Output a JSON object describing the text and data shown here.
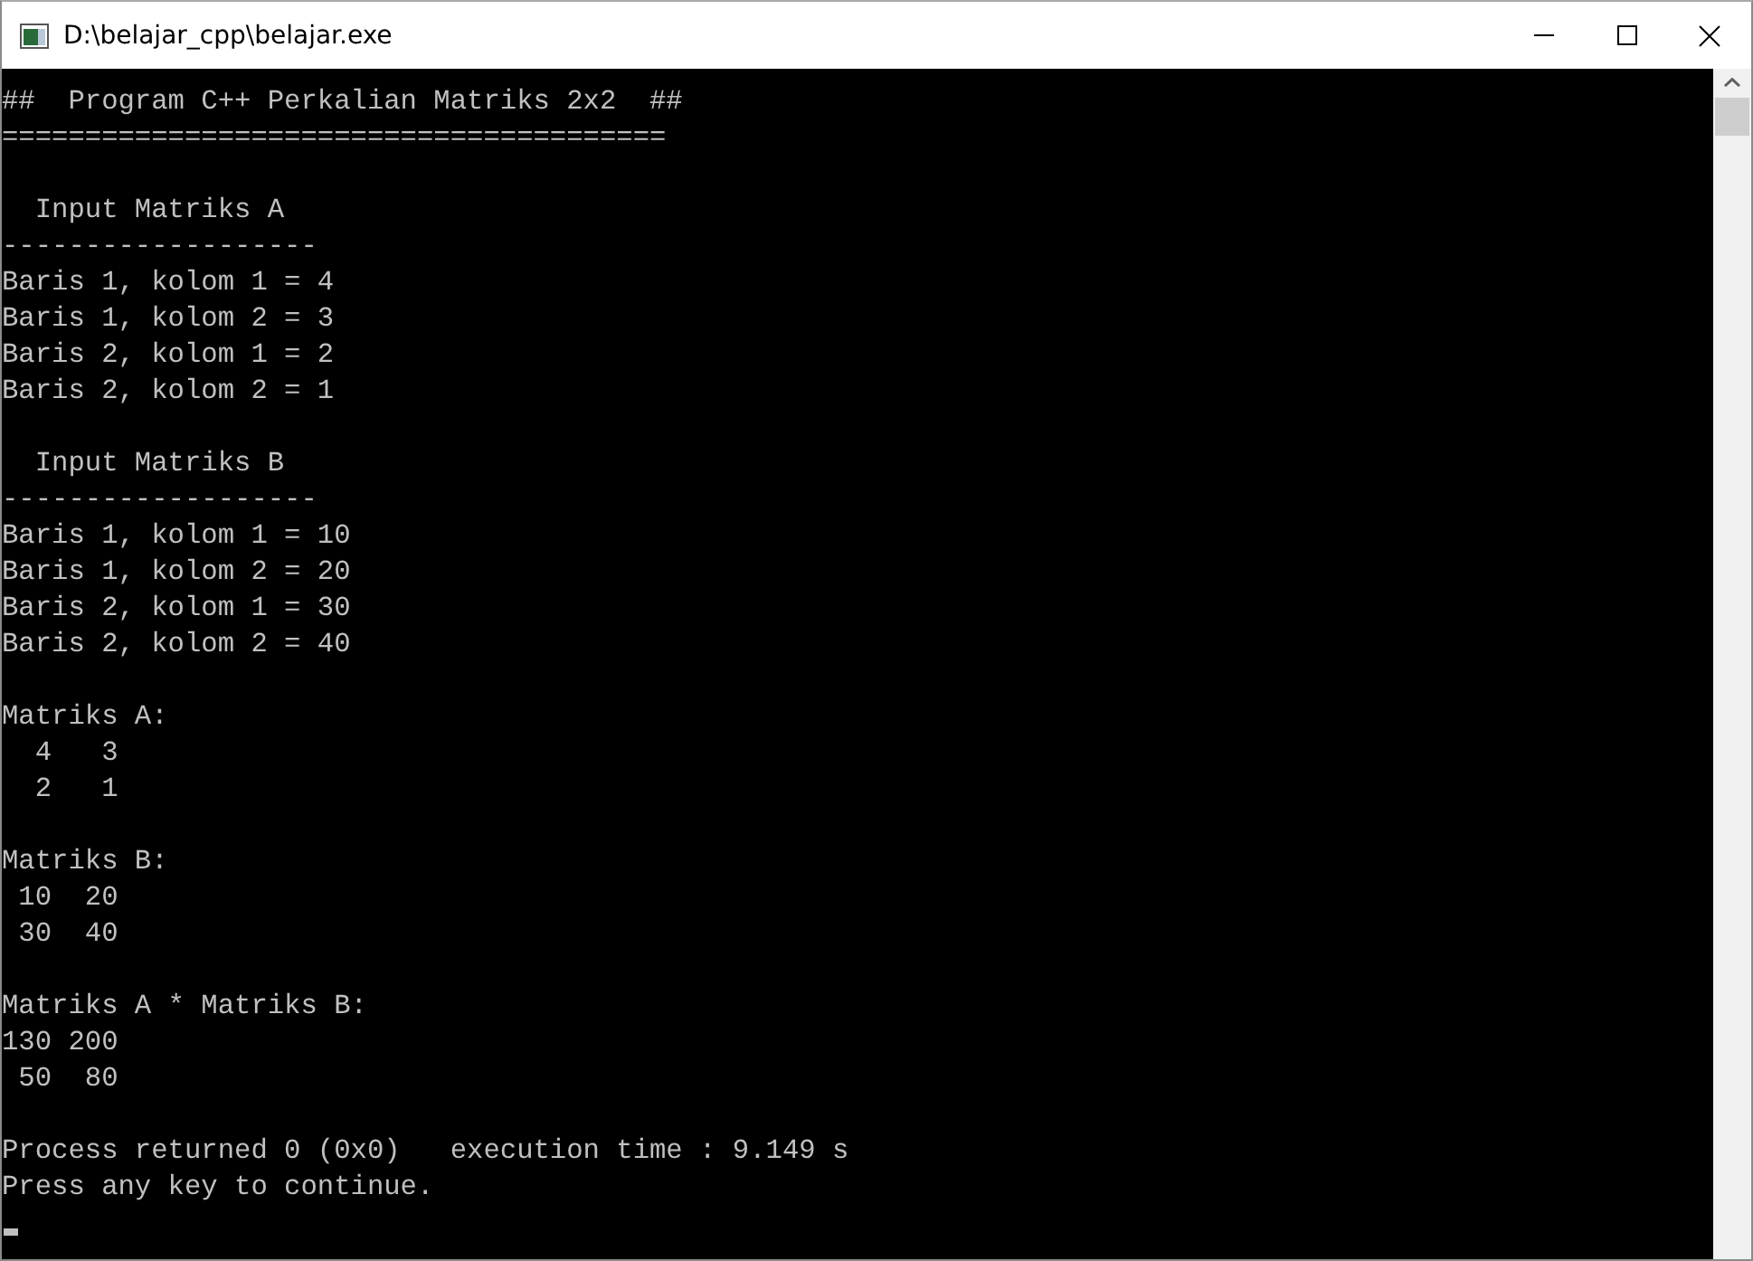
{
  "window": {
    "title": "D:\\belajar_cpp\\belajar.exe"
  },
  "console": {
    "blocks": [
      [
        "##  Program C++ Perkalian Matriks 2x2  ##",
        "========================================"
      ],
      [
        "  Input Matriks A",
        "-------------------",
        "Baris 1, kolom 1 = 4",
        "Baris 1, kolom 2 = 3",
        "Baris 2, kolom 1 = 2",
        "Baris 2, kolom 2 = 1"
      ],
      [
        "  Input Matriks B",
        "-------------------",
        "Baris 1, kolom 1 = 10",
        "Baris 1, kolom 2 = 20",
        "Baris 2, kolom 1 = 30",
        "Baris 2, kolom 2 = 40"
      ],
      [
        "Matriks A:",
        "  4   3",
        "  2   1"
      ],
      [
        "Matriks B:",
        " 10  20",
        " 30  40"
      ],
      [
        "Matriks A * Matriks B:",
        "130 200",
        " 50  80"
      ],
      [
        "Process returned 0 (0x0)   execution time : 9.149 s",
        "Press any key to continue."
      ]
    ],
    "cursor": true
  }
}
